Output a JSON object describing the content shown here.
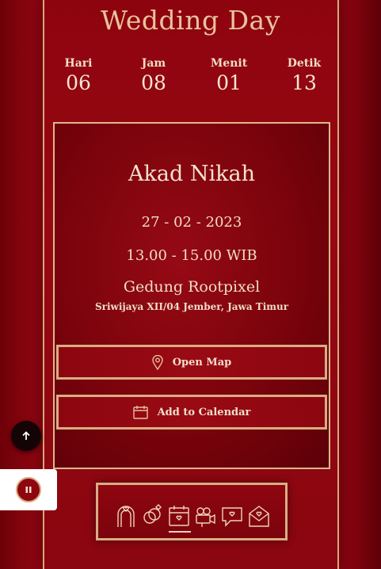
{
  "header": {
    "title": "Wedding Day"
  },
  "countdown": [
    {
      "label": "Hari",
      "value": "06"
    },
    {
      "label": "Jam",
      "value": "08"
    },
    {
      "label": "Menit",
      "value": "01"
    },
    {
      "label": "Detik",
      "value": "13"
    }
  ],
  "event": {
    "title": "Akad Nikah",
    "date": "27 - 02 - 2023",
    "time": "13.00 - 15.00 WIB",
    "venue": "Gedung Rootpixel",
    "address": "Sriwijaya XII/04 Jember, Jawa Timur",
    "open_map_label": "Open Map",
    "calendar_label": "Add to Calendar"
  },
  "colors": {
    "background": "#93070f",
    "accent": "#d9a77a",
    "text": "#f3dfca"
  },
  "icons": {
    "scroll_top": "arrow-up-icon",
    "music": "pause-icon",
    "nav": [
      "couple-arch-icon",
      "rings-icon",
      "calendar-heart-icon",
      "video-camera-icon",
      "chat-heart-icon",
      "envelope-heart-icon"
    ]
  }
}
